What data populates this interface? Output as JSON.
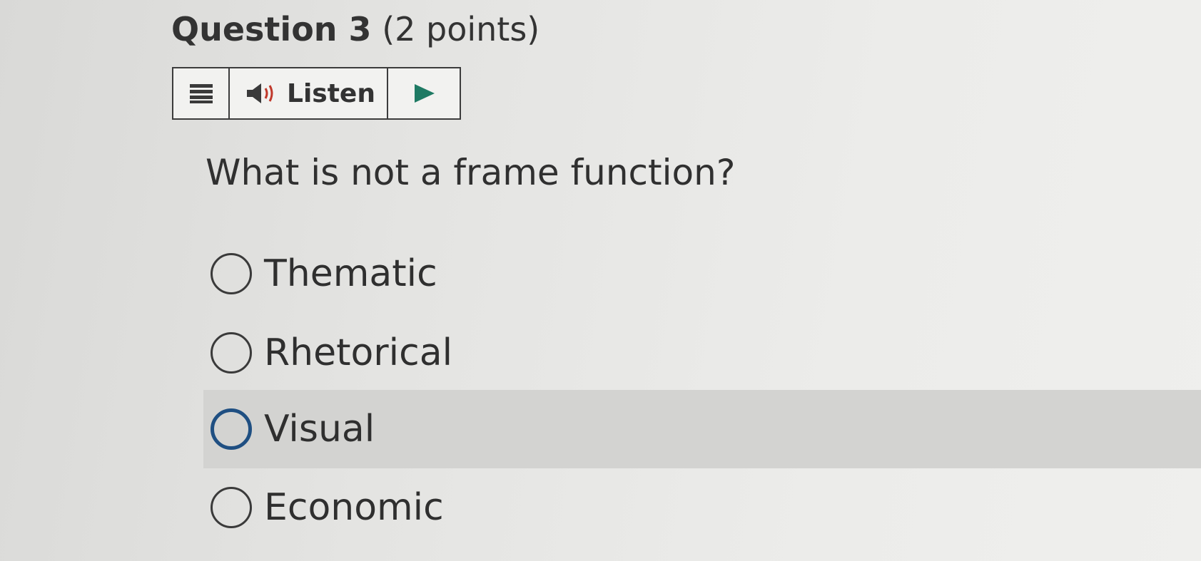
{
  "question": {
    "number_label": "Question 3",
    "points_label": "(2 points)",
    "prompt": "What is not a frame function?"
  },
  "toolbar": {
    "menu_icon": "hamburger-menu-icon",
    "speaker_icon": "speaker-icon",
    "listen_label": "Listen",
    "play_icon": "play-icon"
  },
  "options": [
    {
      "label": "Thematic",
      "highlighted": false
    },
    {
      "label": "Rhetorical",
      "highlighted": false
    },
    {
      "label": "Visual",
      "highlighted": true
    },
    {
      "label": "Economic",
      "highlighted": false
    }
  ],
  "colors": {
    "highlight_row": "#d3d3d1",
    "focus_ring": "#1f4f82",
    "speaker_waves": "#c0392b"
  }
}
